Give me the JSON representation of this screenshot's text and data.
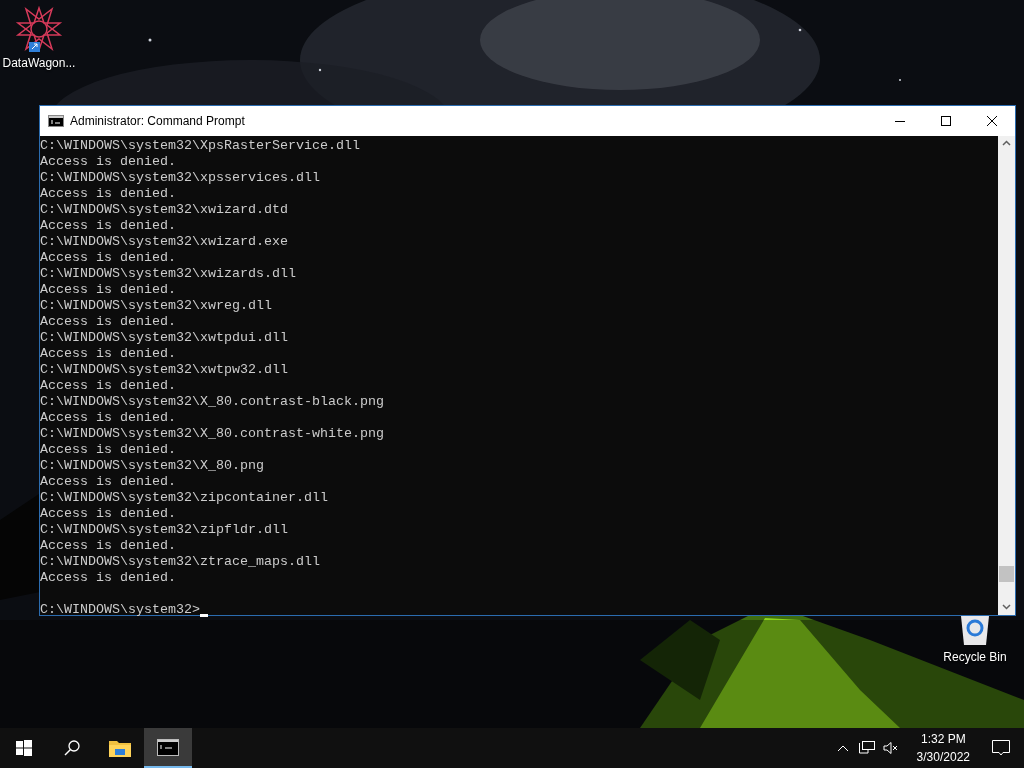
{
  "desktop_icons": [
    {
      "kind": "app",
      "label": "DataWagon..."
    },
    {
      "kind": "recycle",
      "label": "Recycle Bin"
    }
  ],
  "window": {
    "title": "Administrator: Command Prompt",
    "lines": [
      "C:\\WINDOWS\\system32\\XpsRasterService.dll",
      "Access is denied.",
      "C:\\WINDOWS\\system32\\xpsservices.dll",
      "Access is denied.",
      "C:\\WINDOWS\\system32\\xwizard.dtd",
      "Access is denied.",
      "C:\\WINDOWS\\system32\\xwizard.exe",
      "Access is denied.",
      "C:\\WINDOWS\\system32\\xwizards.dll",
      "Access is denied.",
      "C:\\WINDOWS\\system32\\xwreg.dll",
      "Access is denied.",
      "C:\\WINDOWS\\system32\\xwtpdui.dll",
      "Access is denied.",
      "C:\\WINDOWS\\system32\\xwtpw32.dll",
      "Access is denied.",
      "C:\\WINDOWS\\system32\\X_80.contrast-black.png",
      "Access is denied.",
      "C:\\WINDOWS\\system32\\X_80.contrast-white.png",
      "Access is denied.",
      "C:\\WINDOWS\\system32\\X_80.png",
      "Access is denied.",
      "C:\\WINDOWS\\system32\\zipcontainer.dll",
      "Access is denied.",
      "C:\\WINDOWS\\system32\\zipfldr.dll",
      "Access is denied.",
      "C:\\WINDOWS\\system32\\ztrace_maps.dll",
      "Access is denied."
    ],
    "prompt": "C:\\WINDOWS\\system32>"
  },
  "taskbar": {
    "items": [
      {
        "kind": "start",
        "selected": false
      },
      {
        "kind": "search",
        "selected": false
      },
      {
        "kind": "explorer",
        "selected": false
      },
      {
        "kind": "cmd",
        "selected": true
      }
    ],
    "volume": {
      "muted": true
    },
    "time": "1:32 PM",
    "date": "3/30/2022"
  }
}
